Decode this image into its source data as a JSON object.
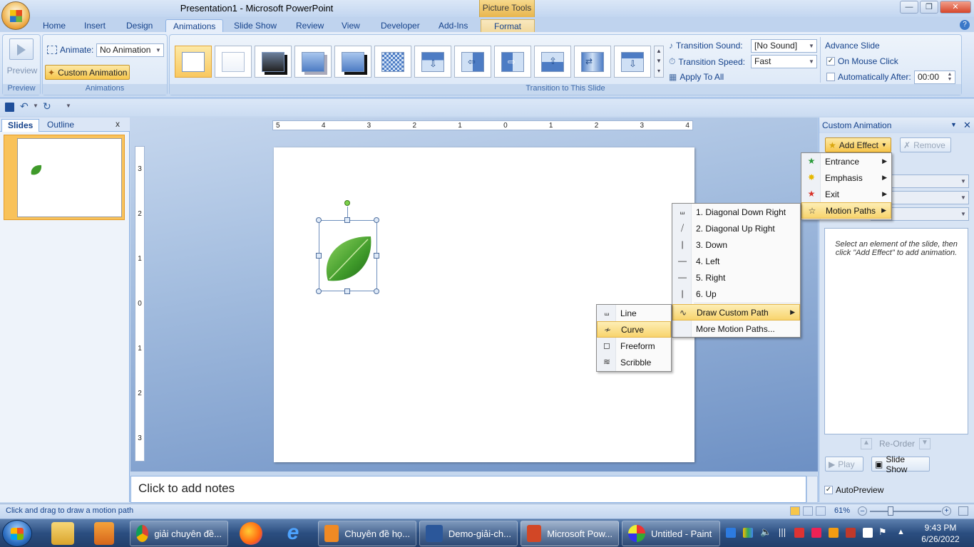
{
  "window": {
    "title": "Presentation1 - Microsoft PowerPoint",
    "contextual_tab_group": "Picture Tools"
  },
  "ribbon_tabs": [
    "Home",
    "Insert",
    "Design",
    "Animations",
    "Slide Show",
    "Review",
    "View",
    "Developer",
    "Add-Ins",
    "Format"
  ],
  "active_tab": "Animations",
  "ribbon": {
    "preview": {
      "button_label": "Preview",
      "group_label": "Preview"
    },
    "animations": {
      "animate_label": "Animate:",
      "animate_value": "No Animation",
      "custom_animation_label": "Custom Animation",
      "group_label": "Animations"
    },
    "transition": {
      "group_label": "Transition to This Slide",
      "sound_label": "Transition Sound:",
      "sound_value": "[No Sound]",
      "speed_label": "Transition Speed:",
      "speed_value": "Fast",
      "apply_all_label": "Apply To All"
    },
    "advance_slide": {
      "title": "Advance Slide",
      "on_mouse_click_label": "On Mouse Click",
      "on_mouse_click_checked": true,
      "auto_after_label": "Automatically After:",
      "auto_after_value": "00:00",
      "auto_after_checked": false
    }
  },
  "slides_panel": {
    "tab_slides": "Slides",
    "tab_outline": "Outline",
    "close": "x",
    "slide_number": "1"
  },
  "ruler": {
    "horizontal": [
      "5",
      "4",
      "3",
      "2",
      "1",
      "0",
      "1",
      "2",
      "3",
      "4"
    ],
    "vertical": [
      "3",
      "2",
      "1",
      "0",
      "1",
      "2",
      "3"
    ]
  },
  "notes": {
    "placeholder": "Click to add notes"
  },
  "status_bar": {
    "message": "Click and drag to draw a motion path",
    "zoom": "61%"
  },
  "task_pane": {
    "title": "Custom Animation",
    "add_effect_label": "Add Effect",
    "remove_label": "Remove",
    "info_text": "Select an element of the slide, then click \"Add Effect\" to add animation.",
    "reorder_label": "Re-Order",
    "play_label": "Play",
    "slide_show_label": "Slide Show",
    "autopreview_label": "AutoPreview",
    "autopreview_checked": true
  },
  "menus": {
    "add_effect": [
      {
        "label": "Entrance",
        "icon": "star-green-icon",
        "submenu": true
      },
      {
        "label": "Emphasis",
        "icon": "star-yellow-icon",
        "submenu": true
      },
      {
        "label": "Exit",
        "icon": "star-red-icon",
        "submenu": true
      },
      {
        "label": "Motion Paths",
        "icon": "star-outline-icon",
        "submenu": true,
        "highlighted": true
      }
    ],
    "motion_paths": [
      {
        "label": "1. Diagonal Down Right"
      },
      {
        "label": "2. Diagonal Up Right"
      },
      {
        "label": "3. Down"
      },
      {
        "label": "4. Left"
      },
      {
        "label": "5. Right"
      },
      {
        "label": "6. Up"
      },
      {
        "label": "Draw Custom Path",
        "submenu": true,
        "highlighted": true
      },
      {
        "label": "More Motion Paths..."
      }
    ],
    "draw_custom_path": [
      {
        "label": "Line"
      },
      {
        "label": "Curve",
        "highlighted": true
      },
      {
        "label": "Freeform"
      },
      {
        "label": "Scribble"
      }
    ]
  },
  "taskbar": {
    "items": [
      {
        "label": "giải chuyên đề..."
      },
      {
        "label": "Chuyên đề họ..."
      },
      {
        "label": "Demo-giải-ch..."
      },
      {
        "label": "Microsoft Pow..."
      },
      {
        "label": "Untitled - Paint"
      }
    ],
    "clock_time": "9:43 PM",
    "clock_date": "6/26/2022"
  },
  "colors": {
    "accent": "#15428b",
    "highlight": "#f8d46d",
    "leaf": "#3f9a2a"
  }
}
